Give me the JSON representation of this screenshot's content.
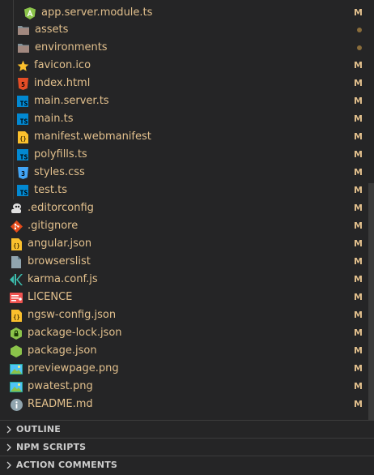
{
  "explorer": {
    "files": [
      {
        "label": "app.server.module.ts",
        "status": "M",
        "icon": "angular-icon"
      },
      {
        "label": "assets",
        "status": "dot",
        "icon": "folder-icon"
      },
      {
        "label": "environments",
        "status": "dot",
        "icon": "folder-icon"
      },
      {
        "label": "favicon.ico",
        "status": "M",
        "icon": "star-icon"
      },
      {
        "label": "index.html",
        "status": "M",
        "icon": "html5-icon"
      },
      {
        "label": "main.server.ts",
        "status": "M",
        "icon": "typescript-icon"
      },
      {
        "label": "main.ts",
        "status": "M",
        "icon": "typescript-icon"
      },
      {
        "label": "manifest.webmanifest",
        "status": "M",
        "icon": "json-icon"
      },
      {
        "label": "polyfills.ts",
        "status": "M",
        "icon": "typescript-icon"
      },
      {
        "label": "styles.css",
        "status": "M",
        "icon": "css3-icon"
      },
      {
        "label": "test.ts",
        "status": "M",
        "icon": "typescript-icon"
      },
      {
        "label": ".editorconfig",
        "status": "M",
        "icon": "editorconfig-icon"
      },
      {
        "label": ".gitignore",
        "status": "M",
        "icon": "git-icon"
      },
      {
        "label": "angular.json",
        "status": "M",
        "icon": "json-icon"
      },
      {
        "label": "browserslist",
        "status": "M",
        "icon": "file-icon"
      },
      {
        "label": "karma.conf.js",
        "status": "M",
        "icon": "karma-icon"
      },
      {
        "label": "LICENCE",
        "status": "M",
        "icon": "license-icon"
      },
      {
        "label": "ngsw-config.json",
        "status": "M",
        "icon": "json-icon"
      },
      {
        "label": "package-lock.json",
        "status": "M",
        "icon": "npm-lock-icon"
      },
      {
        "label": "package.json",
        "status": "M",
        "icon": "nodejs-icon"
      },
      {
        "label": "previewpage.png",
        "status": "M",
        "icon": "image-icon"
      },
      {
        "label": "pwatest.png",
        "status": "M",
        "icon": "image-icon"
      },
      {
        "label": "README.md",
        "status": "M",
        "icon": "info-icon"
      }
    ]
  },
  "sections": [
    {
      "title": "OUTLINE"
    },
    {
      "title": "NPM SCRIPTS"
    },
    {
      "title": "ACTION COMMENTS"
    }
  ],
  "colors": {
    "modified": "#e2c08d",
    "background": "#252526",
    "text": "#cccccc"
  }
}
